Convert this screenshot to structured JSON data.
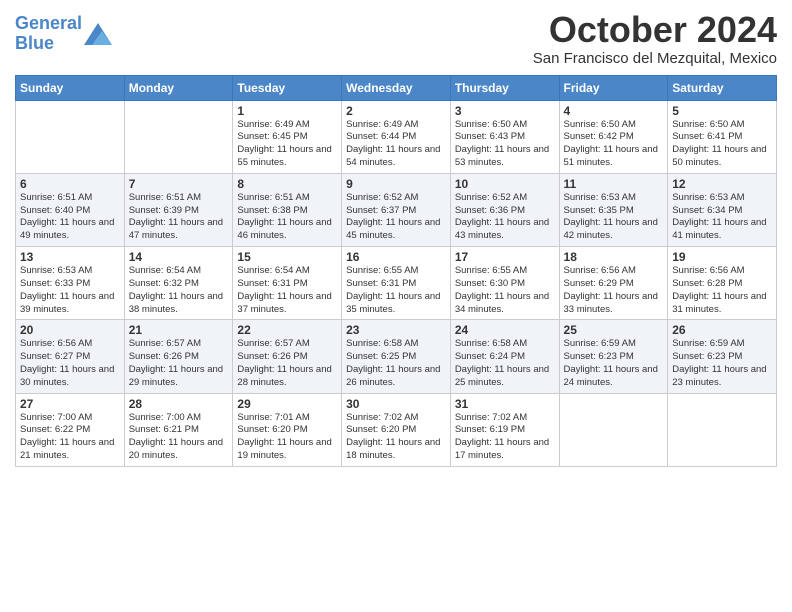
{
  "header": {
    "logo_line1": "General",
    "logo_line2": "Blue",
    "month": "October 2024",
    "location": "San Francisco del Mezquital, Mexico"
  },
  "days_of_week": [
    "Sunday",
    "Monday",
    "Tuesday",
    "Wednesday",
    "Thursday",
    "Friday",
    "Saturday"
  ],
  "weeks": [
    [
      {
        "day": "",
        "info": ""
      },
      {
        "day": "",
        "info": ""
      },
      {
        "day": "1",
        "info": "Sunrise: 6:49 AM\nSunset: 6:45 PM\nDaylight: 11 hours and 55 minutes."
      },
      {
        "day": "2",
        "info": "Sunrise: 6:49 AM\nSunset: 6:44 PM\nDaylight: 11 hours and 54 minutes."
      },
      {
        "day": "3",
        "info": "Sunrise: 6:50 AM\nSunset: 6:43 PM\nDaylight: 11 hours and 53 minutes."
      },
      {
        "day": "4",
        "info": "Sunrise: 6:50 AM\nSunset: 6:42 PM\nDaylight: 11 hours and 51 minutes."
      },
      {
        "day": "5",
        "info": "Sunrise: 6:50 AM\nSunset: 6:41 PM\nDaylight: 11 hours and 50 minutes."
      }
    ],
    [
      {
        "day": "6",
        "info": "Sunrise: 6:51 AM\nSunset: 6:40 PM\nDaylight: 11 hours and 49 minutes."
      },
      {
        "day": "7",
        "info": "Sunrise: 6:51 AM\nSunset: 6:39 PM\nDaylight: 11 hours and 47 minutes."
      },
      {
        "day": "8",
        "info": "Sunrise: 6:51 AM\nSunset: 6:38 PM\nDaylight: 11 hours and 46 minutes."
      },
      {
        "day": "9",
        "info": "Sunrise: 6:52 AM\nSunset: 6:37 PM\nDaylight: 11 hours and 45 minutes."
      },
      {
        "day": "10",
        "info": "Sunrise: 6:52 AM\nSunset: 6:36 PM\nDaylight: 11 hours and 43 minutes."
      },
      {
        "day": "11",
        "info": "Sunrise: 6:53 AM\nSunset: 6:35 PM\nDaylight: 11 hours and 42 minutes."
      },
      {
        "day": "12",
        "info": "Sunrise: 6:53 AM\nSunset: 6:34 PM\nDaylight: 11 hours and 41 minutes."
      }
    ],
    [
      {
        "day": "13",
        "info": "Sunrise: 6:53 AM\nSunset: 6:33 PM\nDaylight: 11 hours and 39 minutes."
      },
      {
        "day": "14",
        "info": "Sunrise: 6:54 AM\nSunset: 6:32 PM\nDaylight: 11 hours and 38 minutes."
      },
      {
        "day": "15",
        "info": "Sunrise: 6:54 AM\nSunset: 6:31 PM\nDaylight: 11 hours and 37 minutes."
      },
      {
        "day": "16",
        "info": "Sunrise: 6:55 AM\nSunset: 6:31 PM\nDaylight: 11 hours and 35 minutes."
      },
      {
        "day": "17",
        "info": "Sunrise: 6:55 AM\nSunset: 6:30 PM\nDaylight: 11 hours and 34 minutes."
      },
      {
        "day": "18",
        "info": "Sunrise: 6:56 AM\nSunset: 6:29 PM\nDaylight: 11 hours and 33 minutes."
      },
      {
        "day": "19",
        "info": "Sunrise: 6:56 AM\nSunset: 6:28 PM\nDaylight: 11 hours and 31 minutes."
      }
    ],
    [
      {
        "day": "20",
        "info": "Sunrise: 6:56 AM\nSunset: 6:27 PM\nDaylight: 11 hours and 30 minutes."
      },
      {
        "day": "21",
        "info": "Sunrise: 6:57 AM\nSunset: 6:26 PM\nDaylight: 11 hours and 29 minutes."
      },
      {
        "day": "22",
        "info": "Sunrise: 6:57 AM\nSunset: 6:26 PM\nDaylight: 11 hours and 28 minutes."
      },
      {
        "day": "23",
        "info": "Sunrise: 6:58 AM\nSunset: 6:25 PM\nDaylight: 11 hours and 26 minutes."
      },
      {
        "day": "24",
        "info": "Sunrise: 6:58 AM\nSunset: 6:24 PM\nDaylight: 11 hours and 25 minutes."
      },
      {
        "day": "25",
        "info": "Sunrise: 6:59 AM\nSunset: 6:23 PM\nDaylight: 11 hours and 24 minutes."
      },
      {
        "day": "26",
        "info": "Sunrise: 6:59 AM\nSunset: 6:23 PM\nDaylight: 11 hours and 23 minutes."
      }
    ],
    [
      {
        "day": "27",
        "info": "Sunrise: 7:00 AM\nSunset: 6:22 PM\nDaylight: 11 hours and 21 minutes."
      },
      {
        "day": "28",
        "info": "Sunrise: 7:00 AM\nSunset: 6:21 PM\nDaylight: 11 hours and 20 minutes."
      },
      {
        "day": "29",
        "info": "Sunrise: 7:01 AM\nSunset: 6:20 PM\nDaylight: 11 hours and 19 minutes."
      },
      {
        "day": "30",
        "info": "Sunrise: 7:02 AM\nSunset: 6:20 PM\nDaylight: 11 hours and 18 minutes."
      },
      {
        "day": "31",
        "info": "Sunrise: 7:02 AM\nSunset: 6:19 PM\nDaylight: 11 hours and 17 minutes."
      },
      {
        "day": "",
        "info": ""
      },
      {
        "day": "",
        "info": ""
      }
    ]
  ]
}
